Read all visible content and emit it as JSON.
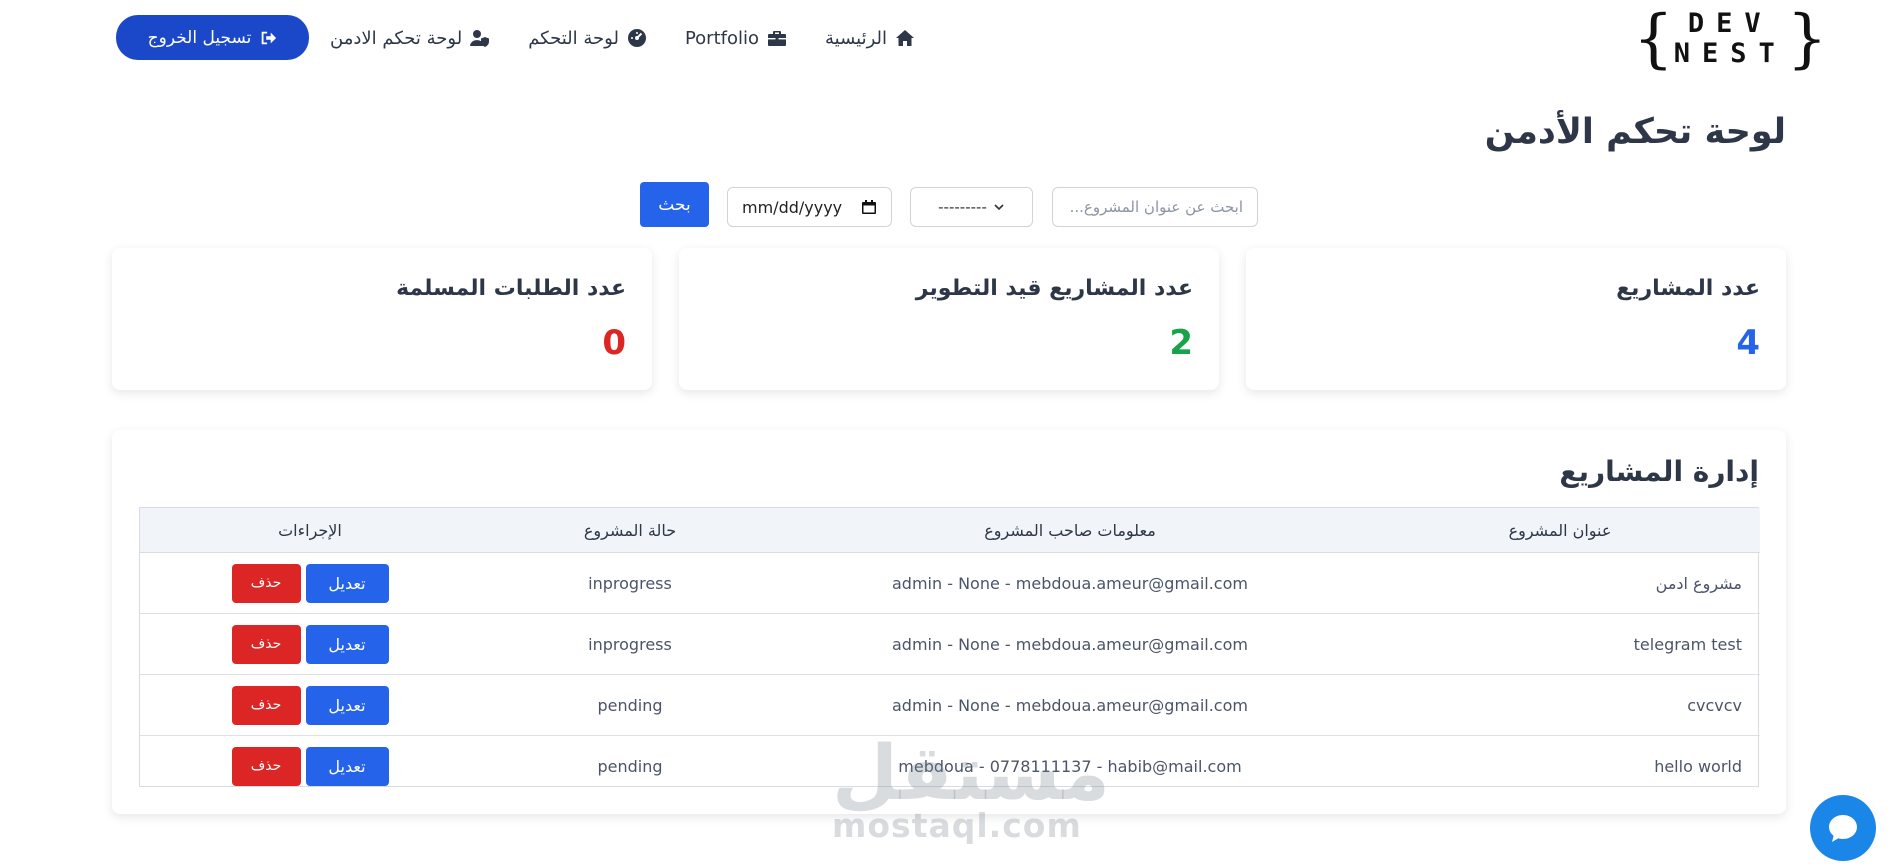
{
  "brand": {
    "logo_line1": "DEV",
    "logo_line2": "NEST",
    "logo_brace_open": "{",
    "logo_brace_close": "}"
  },
  "nav": {
    "items": [
      {
        "label": "الرئيسية",
        "icon": "home-icon"
      },
      {
        "label": "Portfolio",
        "icon": "briefcase-icon"
      },
      {
        "label": "لوحة التحكم",
        "icon": "dashboard-icon"
      },
      {
        "label": "لوحة تحكم الادمن",
        "icon": "user-shield-icon"
      }
    ],
    "logout_label": "تسجيل الخروج",
    "logout_icon": "sign-out-icon"
  },
  "page": {
    "title": "لوحة تحكم الأدمن"
  },
  "filters": {
    "search_placeholder": "ابحث عن عنوان المشروع...",
    "status_selected": "---------",
    "date_placeholder": "mm/dd/yyyy",
    "search_button": "بحث"
  },
  "stats": [
    {
      "label": "عدد المشاريع",
      "value": "4",
      "color": "#2563eb"
    },
    {
      "label": "عدد المشاريع قيد التطوير",
      "value": "2",
      "color": "#16a34a"
    },
    {
      "label": "عدد الطلبات المسلمة",
      "value": "0",
      "color": "#dc2626"
    }
  ],
  "projects": {
    "title": "إدارة المشاريع",
    "columns": [
      "عنوان المشروع",
      "معلومات صاحب المشروع",
      "حالة المشروع",
      "الإجراءات"
    ],
    "edit_label": "تعديل",
    "delete_label": "حذف",
    "rows": [
      {
        "title": "مشروع ادمن",
        "owner": "admin - None - mebdoua.ameur@gmail.com",
        "status": "inprogress"
      },
      {
        "title": "telegram test",
        "owner": "admin - None - mebdoua.ameur@gmail.com",
        "status": "inprogress"
      },
      {
        "title": "cvcvcv",
        "owner": "admin - None - mebdoua.ameur@gmail.com",
        "status": "pending"
      },
      {
        "title": "hello world",
        "owner": "mebdoua - 0778111137 - habib@mail.com",
        "status": "pending"
      }
    ]
  },
  "watermark": {
    "arabic": "مستقل",
    "latin": "mostaql.com"
  },
  "colors": {
    "primary": "#2563eb",
    "logout": "#1a48c9",
    "danger": "#dc2626",
    "success": "#16a34a",
    "chat": "#1a86e8"
  }
}
